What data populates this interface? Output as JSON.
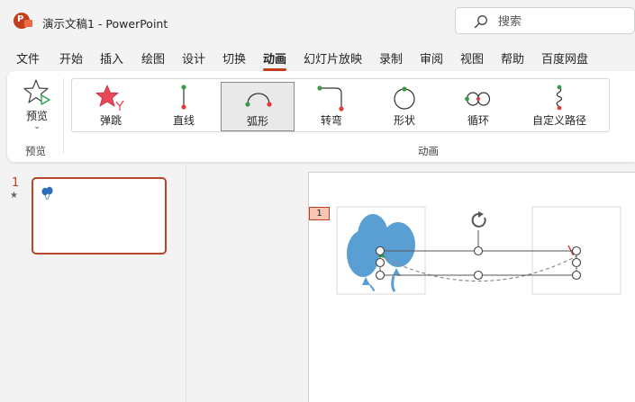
{
  "window": {
    "doc_title": "演示文稿1  -  PowerPoint",
    "logo_letter": "P"
  },
  "search": {
    "placeholder": "搜索"
  },
  "menu": {
    "tabs": [
      "文件",
      "开始",
      "插入",
      "绘图",
      "设计",
      "切换",
      "动画",
      "幻灯片放映",
      "录制",
      "审阅",
      "视图",
      "帮助",
      "百度网盘"
    ],
    "active_tab": "动画"
  },
  "ribbon": {
    "preview_label": "预览",
    "preview_caret": "⌄",
    "group_preview_label": "预览",
    "group_animation_label": "动画",
    "gallery": [
      {
        "label": "弹跳",
        "icon": "bounce-star-icon",
        "selected": false
      },
      {
        "label": "直线",
        "icon": "line-path-icon",
        "selected": false
      },
      {
        "label": "弧形",
        "icon": "arc-path-icon",
        "selected": true
      },
      {
        "label": "转弯",
        "icon": "turn-path-icon",
        "selected": false
      },
      {
        "label": "形状",
        "icon": "shape-path-icon",
        "selected": false
      },
      {
        "label": "循环",
        "icon": "loop-path-icon",
        "selected": false
      },
      {
        "label": "自定义路径",
        "icon": "custom-path-icon",
        "selected": false
      }
    ]
  },
  "slides": {
    "current_number": "1",
    "has_animation_marker": "★",
    "anim_order_tag": "1"
  },
  "colors": {
    "accent": "#c43e1c",
    "balloon": "#5a9fd4",
    "path_start": "#3a9a47",
    "path_end": "#e23b3b"
  }
}
